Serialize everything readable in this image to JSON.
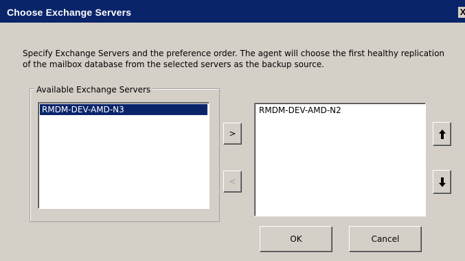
{
  "dialog": {
    "title": "Choose Exchange Servers",
    "close_label": "X"
  },
  "description": {
    "line1": "Specify Exchange Servers and the preference order. The agent will choose the first healthy replication",
    "line2": "of the mailbox database from the selected servers as the backup source."
  },
  "available": {
    "group_label": "Available Exchange Servers",
    "items": [
      {
        "label": "RMDM-DEV-AMD-N3",
        "selected": true
      }
    ]
  },
  "selected": {
    "items": [
      {
        "label": "RMDM-DEV-AMD-N2",
        "selected": false
      }
    ]
  },
  "buttons": {
    "add_label": ">",
    "remove_label": "<",
    "move_up_icon": "arrow-up-icon",
    "move_down_icon": "arrow-down-icon",
    "ok_label": "OK",
    "cancel_label": "Cancel"
  },
  "colors": {
    "titlebar": "#0a246a",
    "dialog_bg": "#d4d0c8",
    "selection": "#0a246a"
  }
}
